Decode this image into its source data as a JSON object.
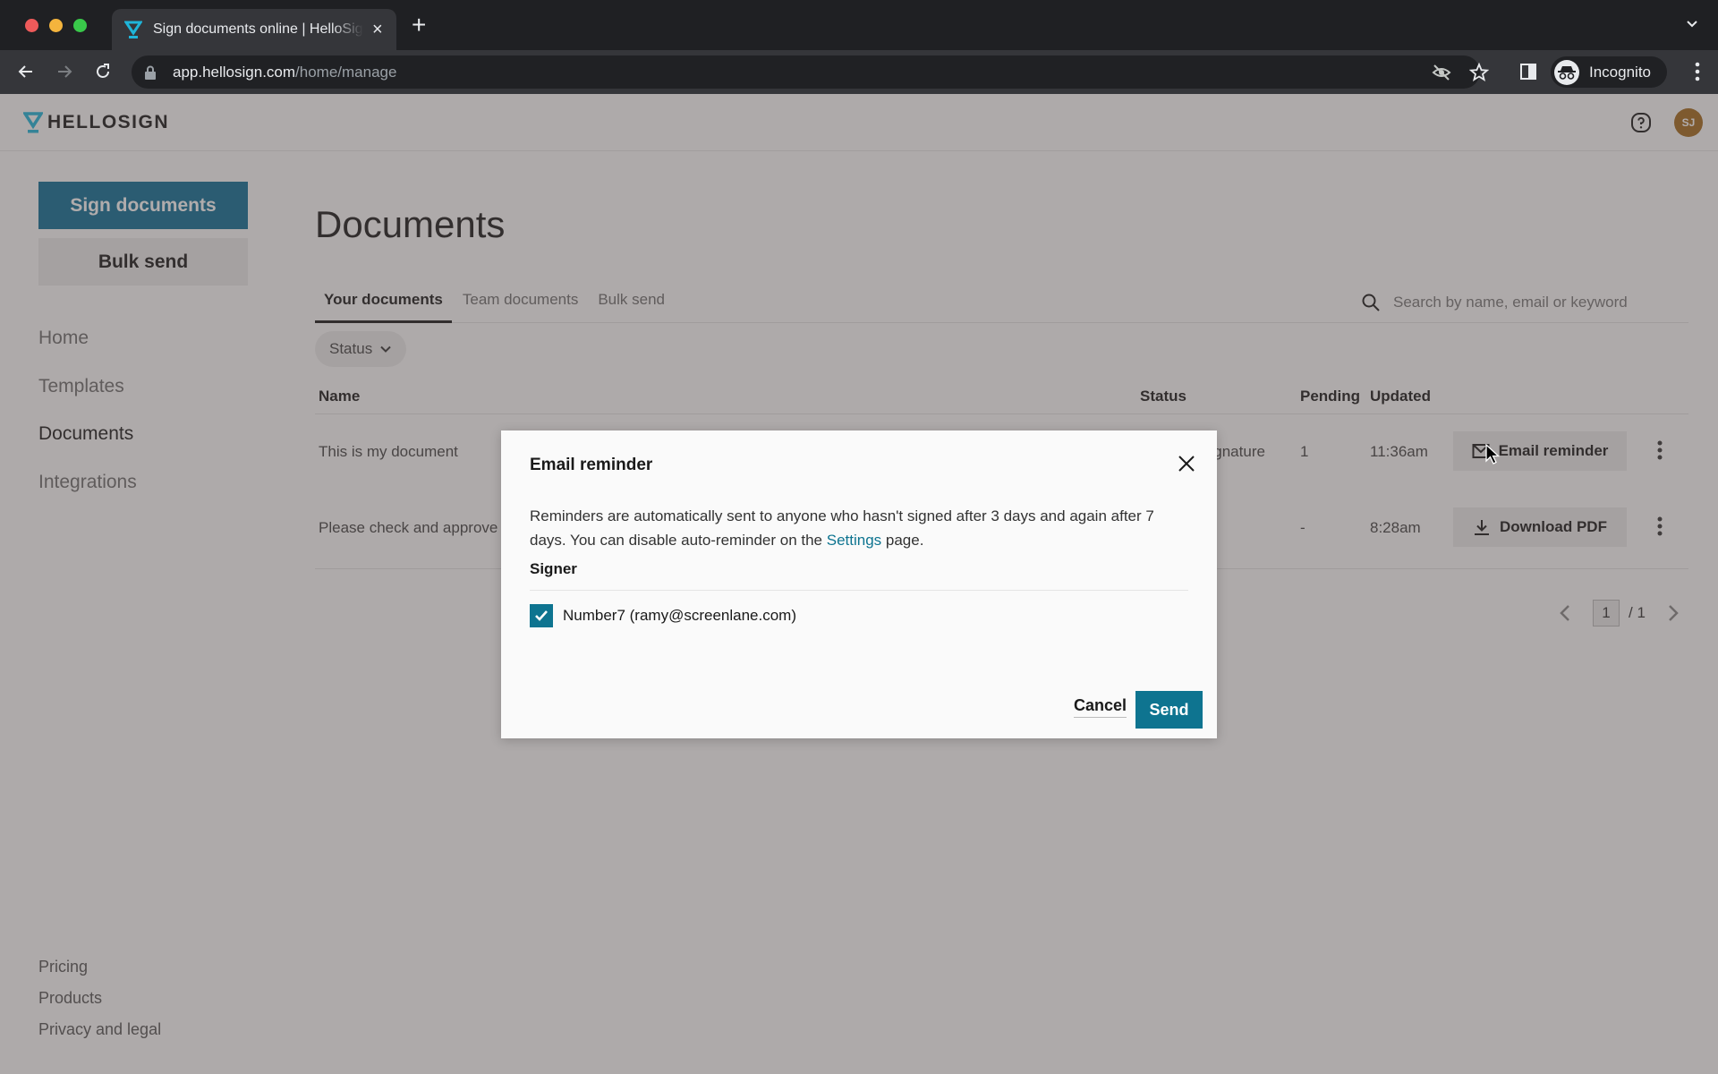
{
  "browser": {
    "tab_title": "Sign documents online | HelloSign",
    "url_host": "app.hellosign.com",
    "url_path": "/home/manage",
    "profile_label": "Incognito",
    "new_tab_label": "+",
    "tab_close_label": "×"
  },
  "app": {
    "logo_text": "HELLOSIGN",
    "avatar_initials": "SJ",
    "brand_color": "#0e7490"
  },
  "sidebar": {
    "primary_button": "Sign documents",
    "secondary_button": "Bulk send",
    "nav": [
      {
        "label": "Home",
        "active": false
      },
      {
        "label": "Templates",
        "active": false
      },
      {
        "label": "Documents",
        "active": true
      },
      {
        "label": "Integrations",
        "active": false
      }
    ],
    "footer": [
      "Pricing",
      "Products",
      "Privacy and legal"
    ]
  },
  "main": {
    "title": "Documents",
    "tabs": [
      {
        "label": "Your documents",
        "active": true
      },
      {
        "label": "Team documents",
        "active": false
      },
      {
        "label": "Bulk send",
        "active": false
      }
    ],
    "search_placeholder": "Search by name, email or keyword",
    "status_filter_label": "Status",
    "columns": [
      "Name",
      "Status",
      "Pending",
      "Updated"
    ],
    "rows": [
      {
        "name": "This is my document",
        "status": "Awaiting signature",
        "status_visible": "signature",
        "pending": "1",
        "updated": "11:36am",
        "action": "Email reminder",
        "action_icon": "envelope-icon"
      },
      {
        "name": "Please check and approve",
        "status": "",
        "status_visible": "",
        "pending": "-",
        "updated": "8:28am",
        "action": "Download PDF",
        "action_icon": "download-icon"
      }
    ],
    "pagination": {
      "current": "1",
      "total_label": "/ 1"
    }
  },
  "modal": {
    "title": "Email reminder",
    "body_before_link": "Reminders are automatically sent to anyone who hasn't signed after 3 days and again after 7 days. You can disable auto-reminder on the ",
    "link_text": "Settings",
    "body_after_link": " page.",
    "signer_heading": "Signer",
    "signers": [
      {
        "label": "Number7 (ramy@screenlane.com)",
        "checked": true
      }
    ],
    "cancel_label": "Cancel",
    "send_label": "Send"
  }
}
